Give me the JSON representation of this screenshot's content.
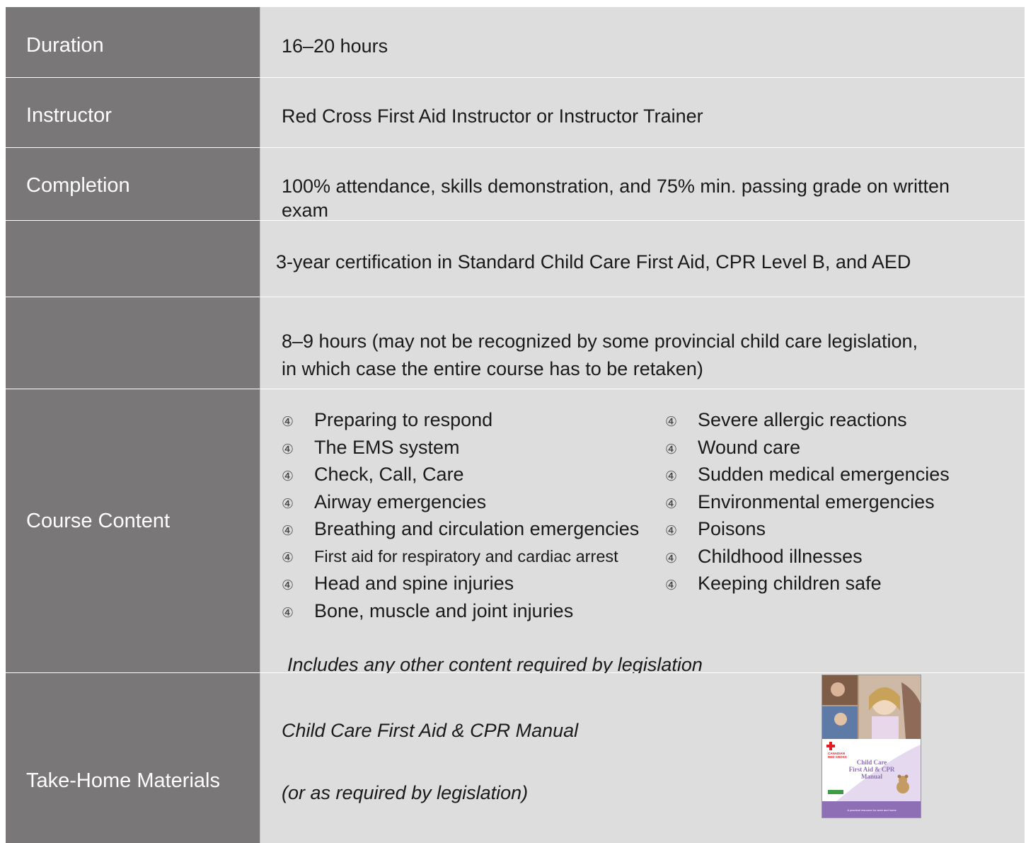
{
  "rows": {
    "duration": {
      "label": "Duration",
      "value": "16–20 hours"
    },
    "instructor": {
      "label": "Instructor",
      "value": "Red Cross First Aid Instructor or Instructor Trainer"
    },
    "completion": {
      "label": "Completion",
      "value_line1": "100% attendance, skills demonstration, and 75% min. passing grade on written",
      "value_line2": "exam"
    },
    "certification": {
      "label": "",
      "value": "3-year certification in Standard Child Care First Aid, CPR Level B, and AED"
    },
    "recert": {
      "label": "",
      "value_line1": "8–9 hours (may not be recognized by some provincial child care legislation,",
      "value_line2": "in which case the entire course has to be retaken)"
    },
    "content": {
      "label": "Course Content",
      "bullet_mark": "④",
      "left_items": [
        "Preparing to respond",
        "The EMS system",
        "Check, Call, Care",
        "Airway emergencies",
        "Breathing and circulation emergencies",
        "First aid for respiratory and cardiac arrest",
        "Head and spine injuries",
        "Bone, muscle and joint injuries"
      ],
      "right_items": [
        "Severe allergic reactions",
        "Wound care",
        "Sudden medical emergencies",
        "Environmental emergencies",
        "Poisons",
        "Childhood illnesses",
        "Keeping children safe"
      ],
      "note": "Includes any other content required by legislation"
    },
    "materials": {
      "label": "Take-Home Materials",
      "value_line1": "Child Care First Aid & CPR Manual",
      "value_line2": "(or as required by legislation)",
      "manual_cover": {
        "org_line1": "CANADIAN",
        "org_line2": "RED CROSS",
        "title_line1": "Child Care",
        "title_line2": "First Aid & CPR",
        "title_line3": "Manual",
        "tagline": "A practical resource for work and home"
      }
    }
  },
  "colors": {
    "label_bg": "#797777",
    "value_bg": "#dddddd",
    "accent_purple": "#8e6fb5",
    "red_cross": "#e31b23"
  }
}
